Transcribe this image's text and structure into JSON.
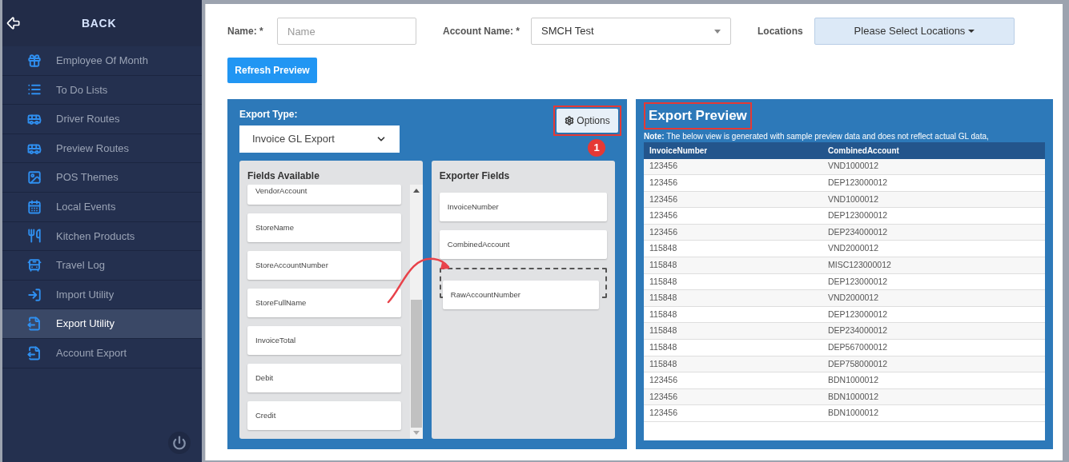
{
  "sidebar": {
    "back_label": "BACK",
    "items": [
      {
        "label": "Employee Of Month",
        "selected": false
      },
      {
        "label": "To Do Lists",
        "selected": false
      },
      {
        "label": "Driver Routes",
        "selected": false
      },
      {
        "label": "Preview Routes",
        "selected": false
      },
      {
        "label": "POS Themes",
        "selected": false
      },
      {
        "label": "Local Events",
        "selected": false
      },
      {
        "label": "Kitchen Products",
        "selected": false
      },
      {
        "label": "Travel Log",
        "selected": false
      },
      {
        "label": "Import Utility",
        "selected": false
      },
      {
        "label": "Export Utility",
        "selected": true
      },
      {
        "label": "Account Export",
        "selected": false
      }
    ]
  },
  "form": {
    "name": {
      "label": "Name: *",
      "placeholder": "Name"
    },
    "account": {
      "label": "Account Name: *",
      "value": "SMCH Test"
    },
    "locations": {
      "label": "Locations",
      "value": "Please Select Locations"
    },
    "refresh_button": "Refresh Preview"
  },
  "export_panel": {
    "type_label": "Export Type:",
    "type_value": "Invoice GL Export",
    "options_button": {
      "label": "Options",
      "highlighted": true
    },
    "callout_badge": "1",
    "fields_available": {
      "title": "Fields Available",
      "items": [
        "VendorAccount",
        "StoreName",
        "StoreAccountNumber",
        "StoreFullName",
        "InvoiceTotal",
        "Debit",
        "Credit"
      ]
    },
    "exporter_fields": {
      "title": "Exporter Fields",
      "items": [
        "InvoiceNumber",
        "CombinedAccount"
      ],
      "dragging": "RawAccountNumber"
    }
  },
  "preview": {
    "title": "Export Preview",
    "highlighted": true,
    "note": "**Note:** The below view is generated with sample preview data and does not reflect actual GL data,",
    "columns": [
      "InvoiceNumber",
      "CombinedAccount"
    ],
    "rows": [
      [
        "123456",
        "VND1000012"
      ],
      [
        "123456",
        "DEP123000012"
      ],
      [
        "123456",
        "VND1000012"
      ],
      [
        "123456",
        "DEP123000012"
      ],
      [
        "123456",
        "DEP234000012"
      ],
      [
        "115848",
        "VND2000012"
      ],
      [
        "115848",
        "MISC123000012"
      ],
      [
        "115848",
        "DEP123000012"
      ],
      [
        "115848",
        "VND2000012"
      ],
      [
        "115848",
        "DEP123000012"
      ],
      [
        "115848",
        "DEP234000012"
      ],
      [
        "115848",
        "DEP567000012"
      ],
      [
        "115848",
        "DEP758000012"
      ],
      [
        "123456",
        "BDN1000012"
      ],
      [
        "123456",
        "BDN1000012"
      ],
      [
        "123456",
        "BDN1000012"
      ]
    ]
  }
}
